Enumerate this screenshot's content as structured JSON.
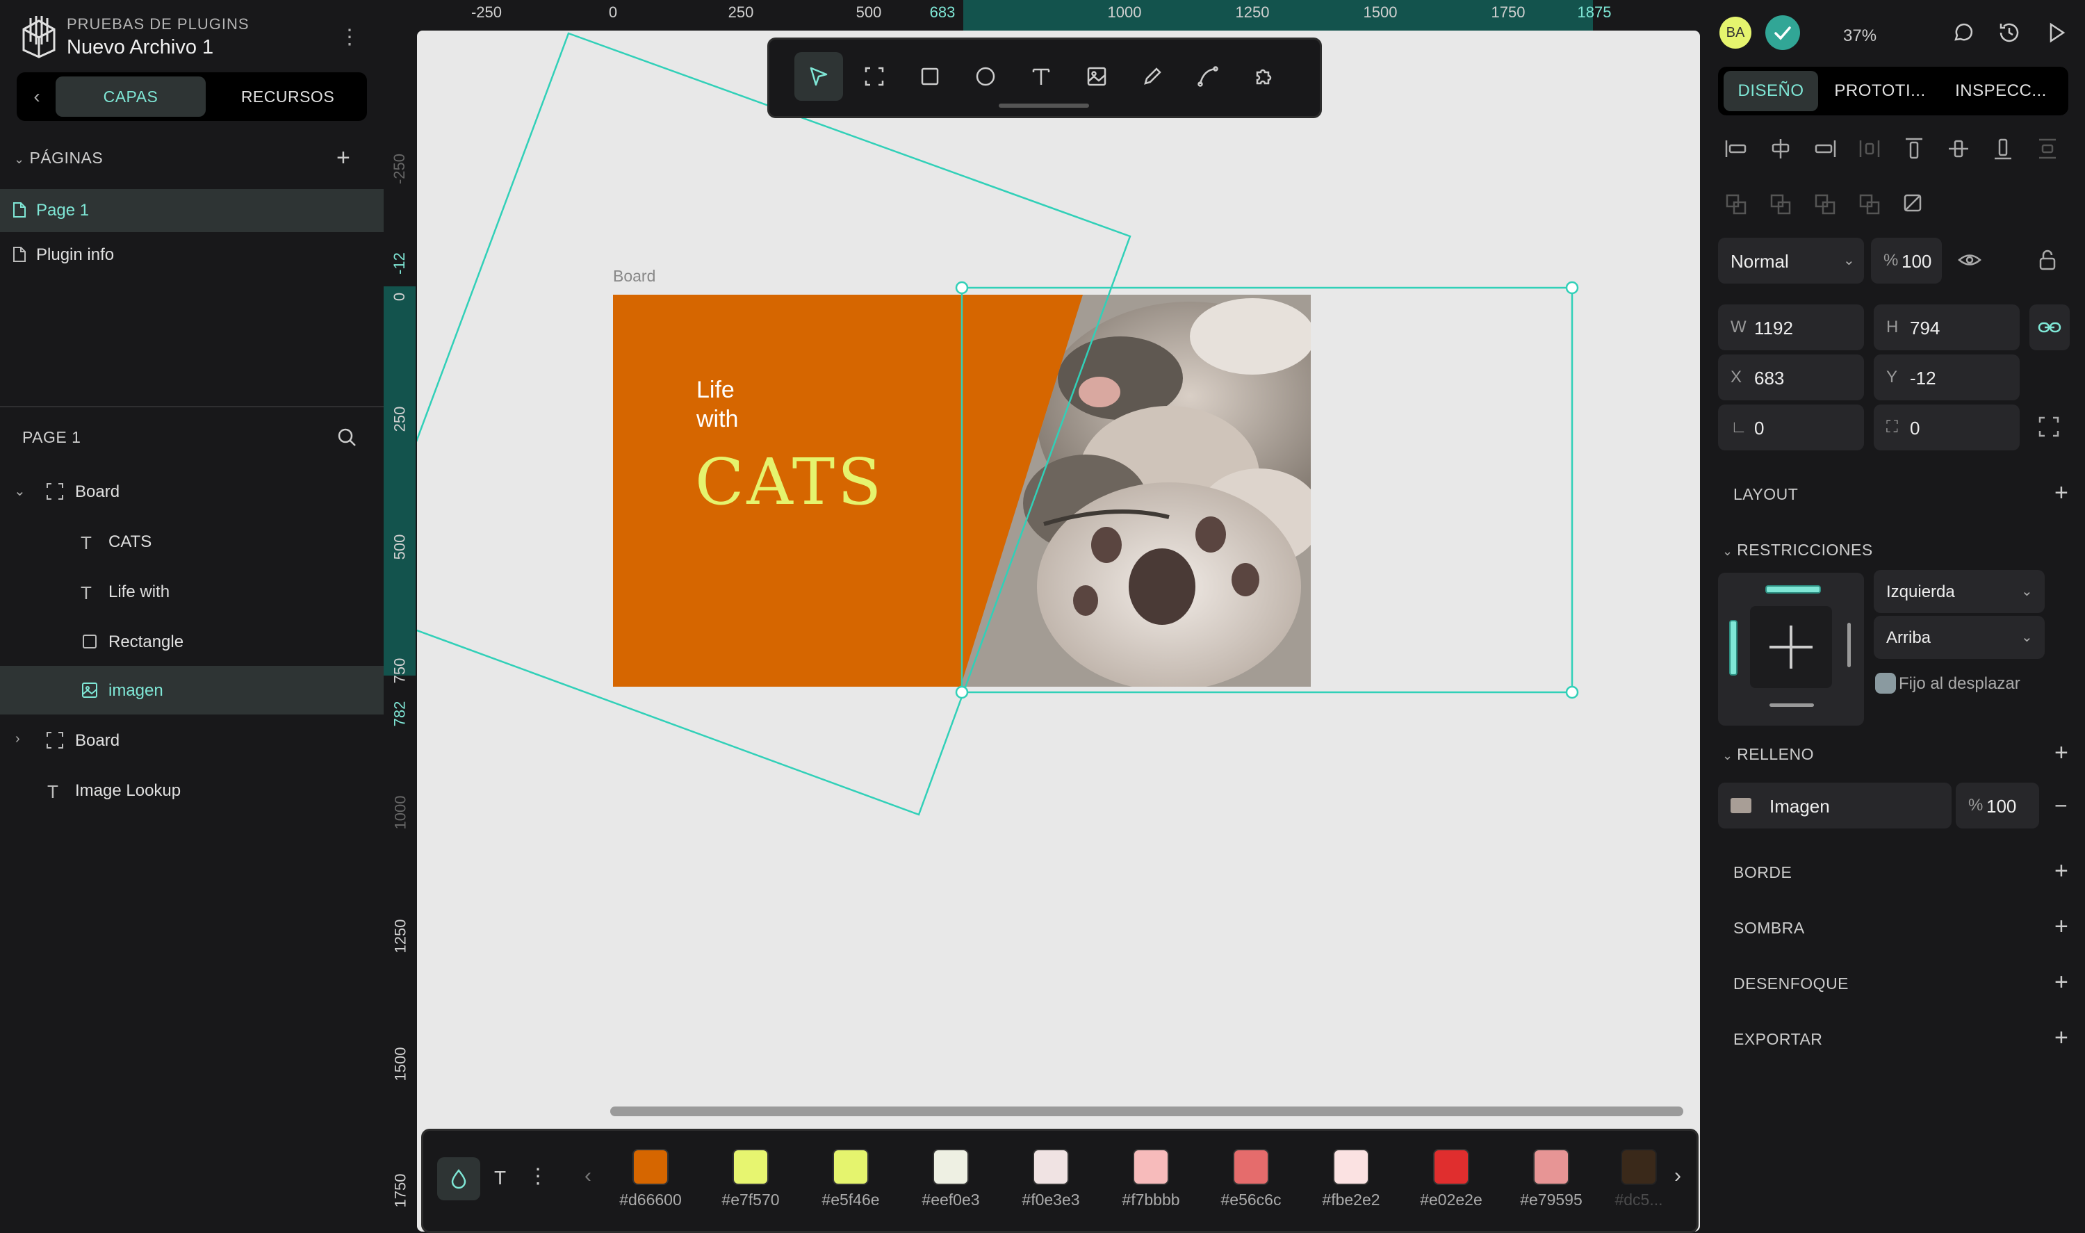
{
  "project": {
    "label": "PRUEBAS DE PLUGINS",
    "file_name": "Nuevo Archivo 1"
  },
  "left_tabs": {
    "layers": "CAPAS",
    "resources": "RECURSOS"
  },
  "pages": {
    "title": "PÁGINAS",
    "items": [
      {
        "label": "Page 1",
        "selected": true
      },
      {
        "label": "Plugin info",
        "selected": false
      }
    ]
  },
  "layers": {
    "title": "PAGE 1",
    "items": [
      {
        "label": "Board",
        "type": "board",
        "expanded": true
      },
      {
        "label": "CATS",
        "type": "text"
      },
      {
        "label": "Life with",
        "type": "text"
      },
      {
        "label": "Rectangle",
        "type": "rect"
      },
      {
        "label": "imagen",
        "type": "image",
        "selected": true
      },
      {
        "label": "Board",
        "type": "board",
        "expanded": false
      },
      {
        "label": "Image Lookup",
        "type": "text"
      }
    ]
  },
  "ruler": {
    "top": [
      "-250",
      "0",
      "250",
      "500",
      "683",
      "1000",
      "1250",
      "1500",
      "1750",
      "1875"
    ],
    "left": [
      "-250",
      "-12",
      "0",
      "250",
      "500",
      "750",
      "782",
      "1000",
      "1250",
      "1500",
      "1750"
    ]
  },
  "canvas": {
    "board_label": "Board",
    "life_with": "Life\nwith",
    "cats": "CATS",
    "board_color": "#d66600",
    "title_color": "#e5f46e",
    "selection_color": "#31d0b8"
  },
  "palette": [
    {
      "hex": "#d66600"
    },
    {
      "hex": "#e7f570"
    },
    {
      "hex": "#e5f46e"
    },
    {
      "hex": "#eef0e3"
    },
    {
      "hex": "#f0e3e3"
    },
    {
      "hex": "#f7bbbb"
    },
    {
      "hex": "#e56c6c"
    },
    {
      "hex": "#fbe2e2"
    },
    {
      "hex": "#e02e2e"
    },
    {
      "hex": "#e79595"
    },
    {
      "hex": "#dc5..."
    }
  ],
  "right": {
    "avatar": "BA",
    "zoom": "37%",
    "tabs": [
      "DISEÑO",
      "PROTOTI...",
      "INSPECC..."
    ],
    "blend_mode": "Normal",
    "opacity": "100",
    "width": "1192",
    "height": "794",
    "x": "683",
    "y": "-12",
    "rotation": "0",
    "radius": "0",
    "sections": {
      "layout": "LAYOUT",
      "constraints": "RESTRICCIONES",
      "fill": "RELLENO",
      "border": "BORDE",
      "shadow": "SOMBRA",
      "blur": "DESENFOQUE",
      "export": "EXPORTAR"
    },
    "constraint_h": "Izquierda",
    "constraint_v": "Arriba",
    "fixed_scroll": "Fijo al desplazar",
    "fill_label": "Imagen",
    "fill_opacity": "100"
  }
}
